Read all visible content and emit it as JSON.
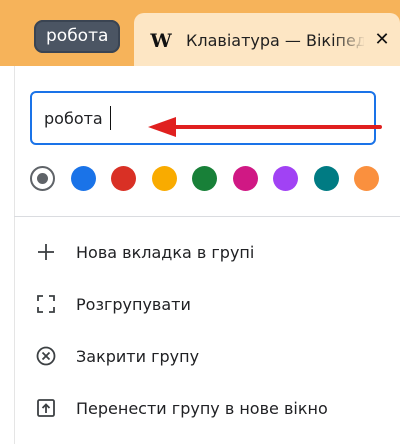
{
  "tab_group": {
    "name": "робота"
  },
  "tab": {
    "favicon": "W",
    "title": "Клавіатура — Вікіпедія",
    "close_symbol": "✕"
  },
  "group_editor": {
    "name_value": "робота",
    "colors": [
      {
        "name": "grey",
        "hex": "#5f6368",
        "selected": true
      },
      {
        "name": "blue",
        "hex": "#1a73e8",
        "selected": false
      },
      {
        "name": "red",
        "hex": "#d93025",
        "selected": false
      },
      {
        "name": "yellow",
        "hex": "#f9ab00",
        "selected": false
      },
      {
        "name": "green",
        "hex": "#188038",
        "selected": false
      },
      {
        "name": "pink",
        "hex": "#d01884",
        "selected": false
      },
      {
        "name": "purple",
        "hex": "#a142f4",
        "selected": false
      },
      {
        "name": "cyan",
        "hex": "#007b83",
        "selected": false
      },
      {
        "name": "orange",
        "hex": "#fa903e",
        "selected": false
      }
    ]
  },
  "menu": [
    {
      "icon": "plus-icon",
      "label": "Нова вкладка в групі"
    },
    {
      "icon": "ungroup-icon",
      "label": "Розгрупувати"
    },
    {
      "icon": "close-circle-icon",
      "label": "Закрити групу"
    },
    {
      "icon": "move-to-window-icon",
      "label": "Перенести групу в нове вікно"
    }
  ],
  "colors": {
    "tabstrip": "#f6b35a",
    "tab_bg": "#fde6c4",
    "group_chip": "#4b5563",
    "input_border": "#1a73e8",
    "annotation_arrow": "#e0201f"
  }
}
